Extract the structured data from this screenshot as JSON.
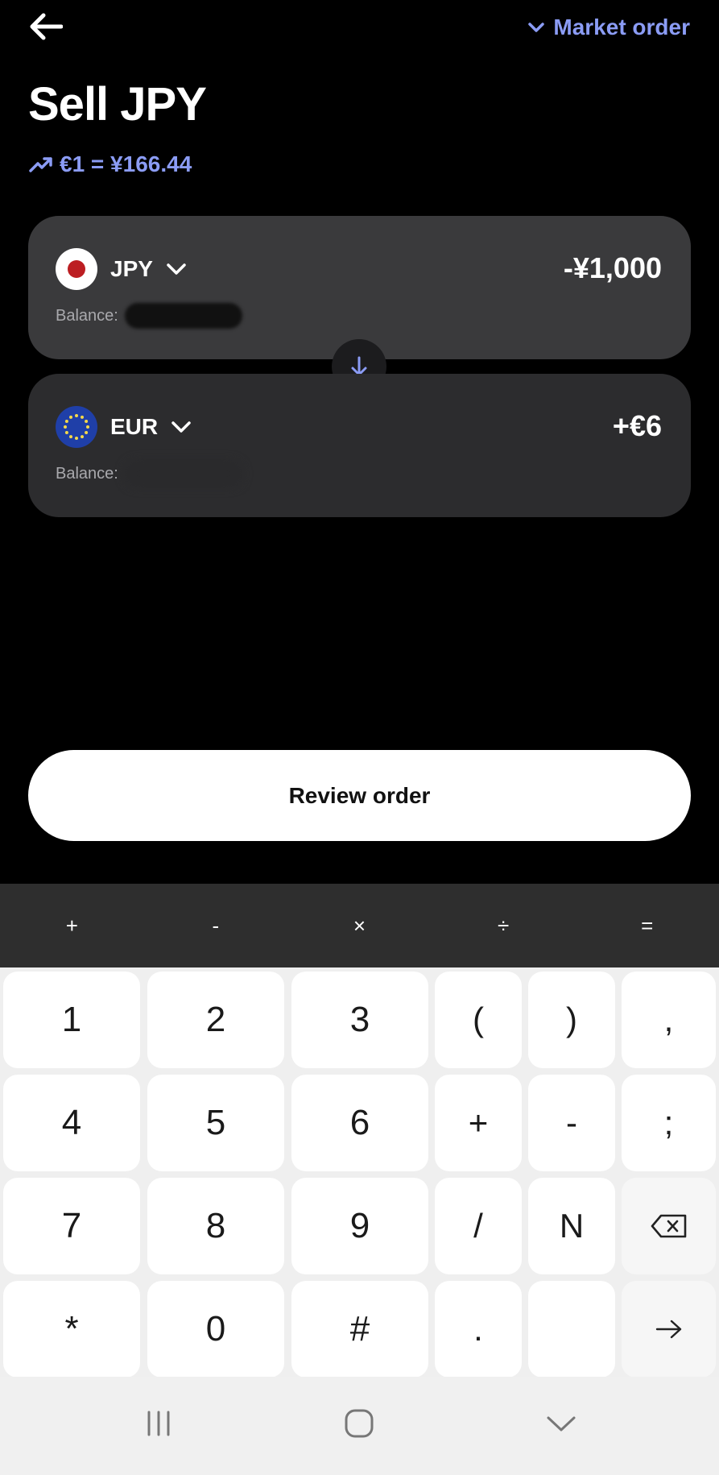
{
  "header": {
    "back_icon": "arrow-left-icon",
    "order_type_label": "Market order",
    "order_type_icon": "chevron-down-icon"
  },
  "title": "Sell JPY",
  "rate": {
    "icon": "trending-up-icon",
    "text": "€1 = ¥166.44"
  },
  "sell_card": {
    "currency": "JPY",
    "flag": "japan-flag-icon",
    "amount": "-¥1,000",
    "balance_label": "Balance:"
  },
  "buy_card": {
    "currency": "EUR",
    "flag": "eu-flag-icon",
    "amount": "+€6",
    "balance_label": "Balance:"
  },
  "swap_icon": "arrow-down-icon",
  "review_button": "Review order",
  "operators": [
    "+",
    "-",
    "×",
    "÷",
    "="
  ],
  "keyboard": {
    "rows": [
      [
        "1",
        "2",
        "3",
        "(",
        ")",
        ","
      ],
      [
        "4",
        "5",
        "6",
        "+",
        "-",
        ";"
      ],
      [
        "7",
        "8",
        "9",
        "/",
        "N",
        "backspace"
      ],
      [
        "*",
        "0",
        "#",
        ".",
        "",
        "enter"
      ]
    ],
    "backspace_icon": "backspace-icon",
    "enter_icon": "arrow-right-icon"
  },
  "navbar": {
    "recents_icon": "recent-apps-icon",
    "home_icon": "home-icon",
    "hide_keyboard_icon": "chevron-down-icon"
  },
  "colors": {
    "accent": "#8b9cf5",
    "background": "#000000",
    "card_sell": "#3a3a3c",
    "card_buy": "#2c2c2e"
  }
}
